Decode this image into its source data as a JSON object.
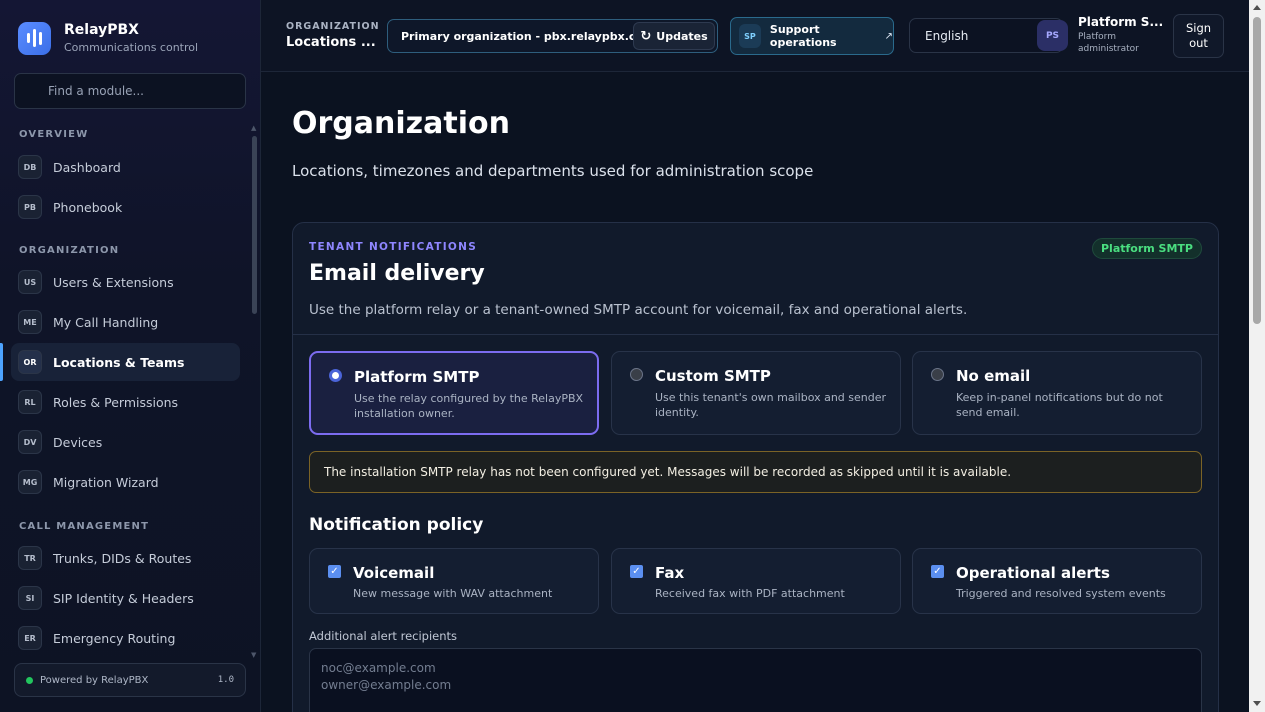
{
  "brand": {
    "name": "RelayPBX",
    "subtitle": "Communications control"
  },
  "sidebar": {
    "search_placeholder": "Find a module...",
    "sections": {
      "overview": "OVERVIEW",
      "organization": "ORGANIZATION",
      "call_management": "CALL MANAGEMENT"
    },
    "items": [
      {
        "badge": "DB",
        "label": "Dashboard"
      },
      {
        "badge": "PB",
        "label": "Phonebook"
      },
      {
        "badge": "US",
        "label": "Users & Extensions"
      },
      {
        "badge": "ME",
        "label": "My Call Handling"
      },
      {
        "badge": "OR",
        "label": "Locations & Teams",
        "active": true
      },
      {
        "badge": "RL",
        "label": "Roles & Permissions"
      },
      {
        "badge": "DV",
        "label": "Devices"
      },
      {
        "badge": "MG",
        "label": "Migration Wizard"
      },
      {
        "badge": "TR",
        "label": "Trunks, DIDs & Routes"
      },
      {
        "badge": "SI",
        "label": "SIP Identity & Headers"
      },
      {
        "badge": "ER",
        "label": "Emergency Routing"
      }
    ],
    "footer": {
      "text": "Powered by RelayPBX",
      "version": "1.0",
      "status_color": "#22c55e"
    }
  },
  "topbar": {
    "crumb_key": "ORGANIZATION",
    "crumb_value": "Locations ...",
    "org_selected": "Primary organization - pbx.relaypbx.com",
    "updates_label": "Updates",
    "support_badge": "SP",
    "support_label": "Support operations",
    "language": "English",
    "avatar_initials": "PS",
    "user_name": "Platform S...",
    "user_role": "Platform administrator",
    "signout_line1": "Sign",
    "signout_line2": "out"
  },
  "page": {
    "title": "Organization",
    "subtitle": "Locations, timezones and departments used for administration scope"
  },
  "email_card": {
    "eyebrow": "TENANT NOTIFICATIONS",
    "title": "Email delivery",
    "description": "Use the platform relay or a tenant-owned SMTP account for voicemail, fax and operational alerts.",
    "status_pill": "Platform SMTP",
    "options": [
      {
        "title": "Platform SMTP",
        "description": "Use the relay configured by the RelayPBX installation owner.",
        "selected": true
      },
      {
        "title": "Custom SMTP",
        "description": "Use this tenant's own mailbox and sender identity.",
        "selected": false
      },
      {
        "title": "No email",
        "description": "Keep in-panel notifications but do not send email.",
        "selected": false
      }
    ],
    "alert": "The installation SMTP relay has not been configured yet. Messages will be recorded as skipped until it is available.",
    "policy_title": "Notification policy",
    "policies": [
      {
        "title": "Voicemail",
        "description": "New message with WAV attachment",
        "checked": true
      },
      {
        "title": "Fax",
        "description": "Received fax with PDF attachment",
        "checked": true
      },
      {
        "title": "Operational alerts",
        "description": "Triggered and resolved system events",
        "checked": true
      }
    ],
    "recipients_label": "Additional alert recipients",
    "recipients_placeholder": "noc@example.com\nowner@example.com"
  },
  "colors": {
    "accent": "#7c6cf0",
    "active_nav": "#4da3ff",
    "success": "#4ade80",
    "warning_border": "#7b6326"
  }
}
